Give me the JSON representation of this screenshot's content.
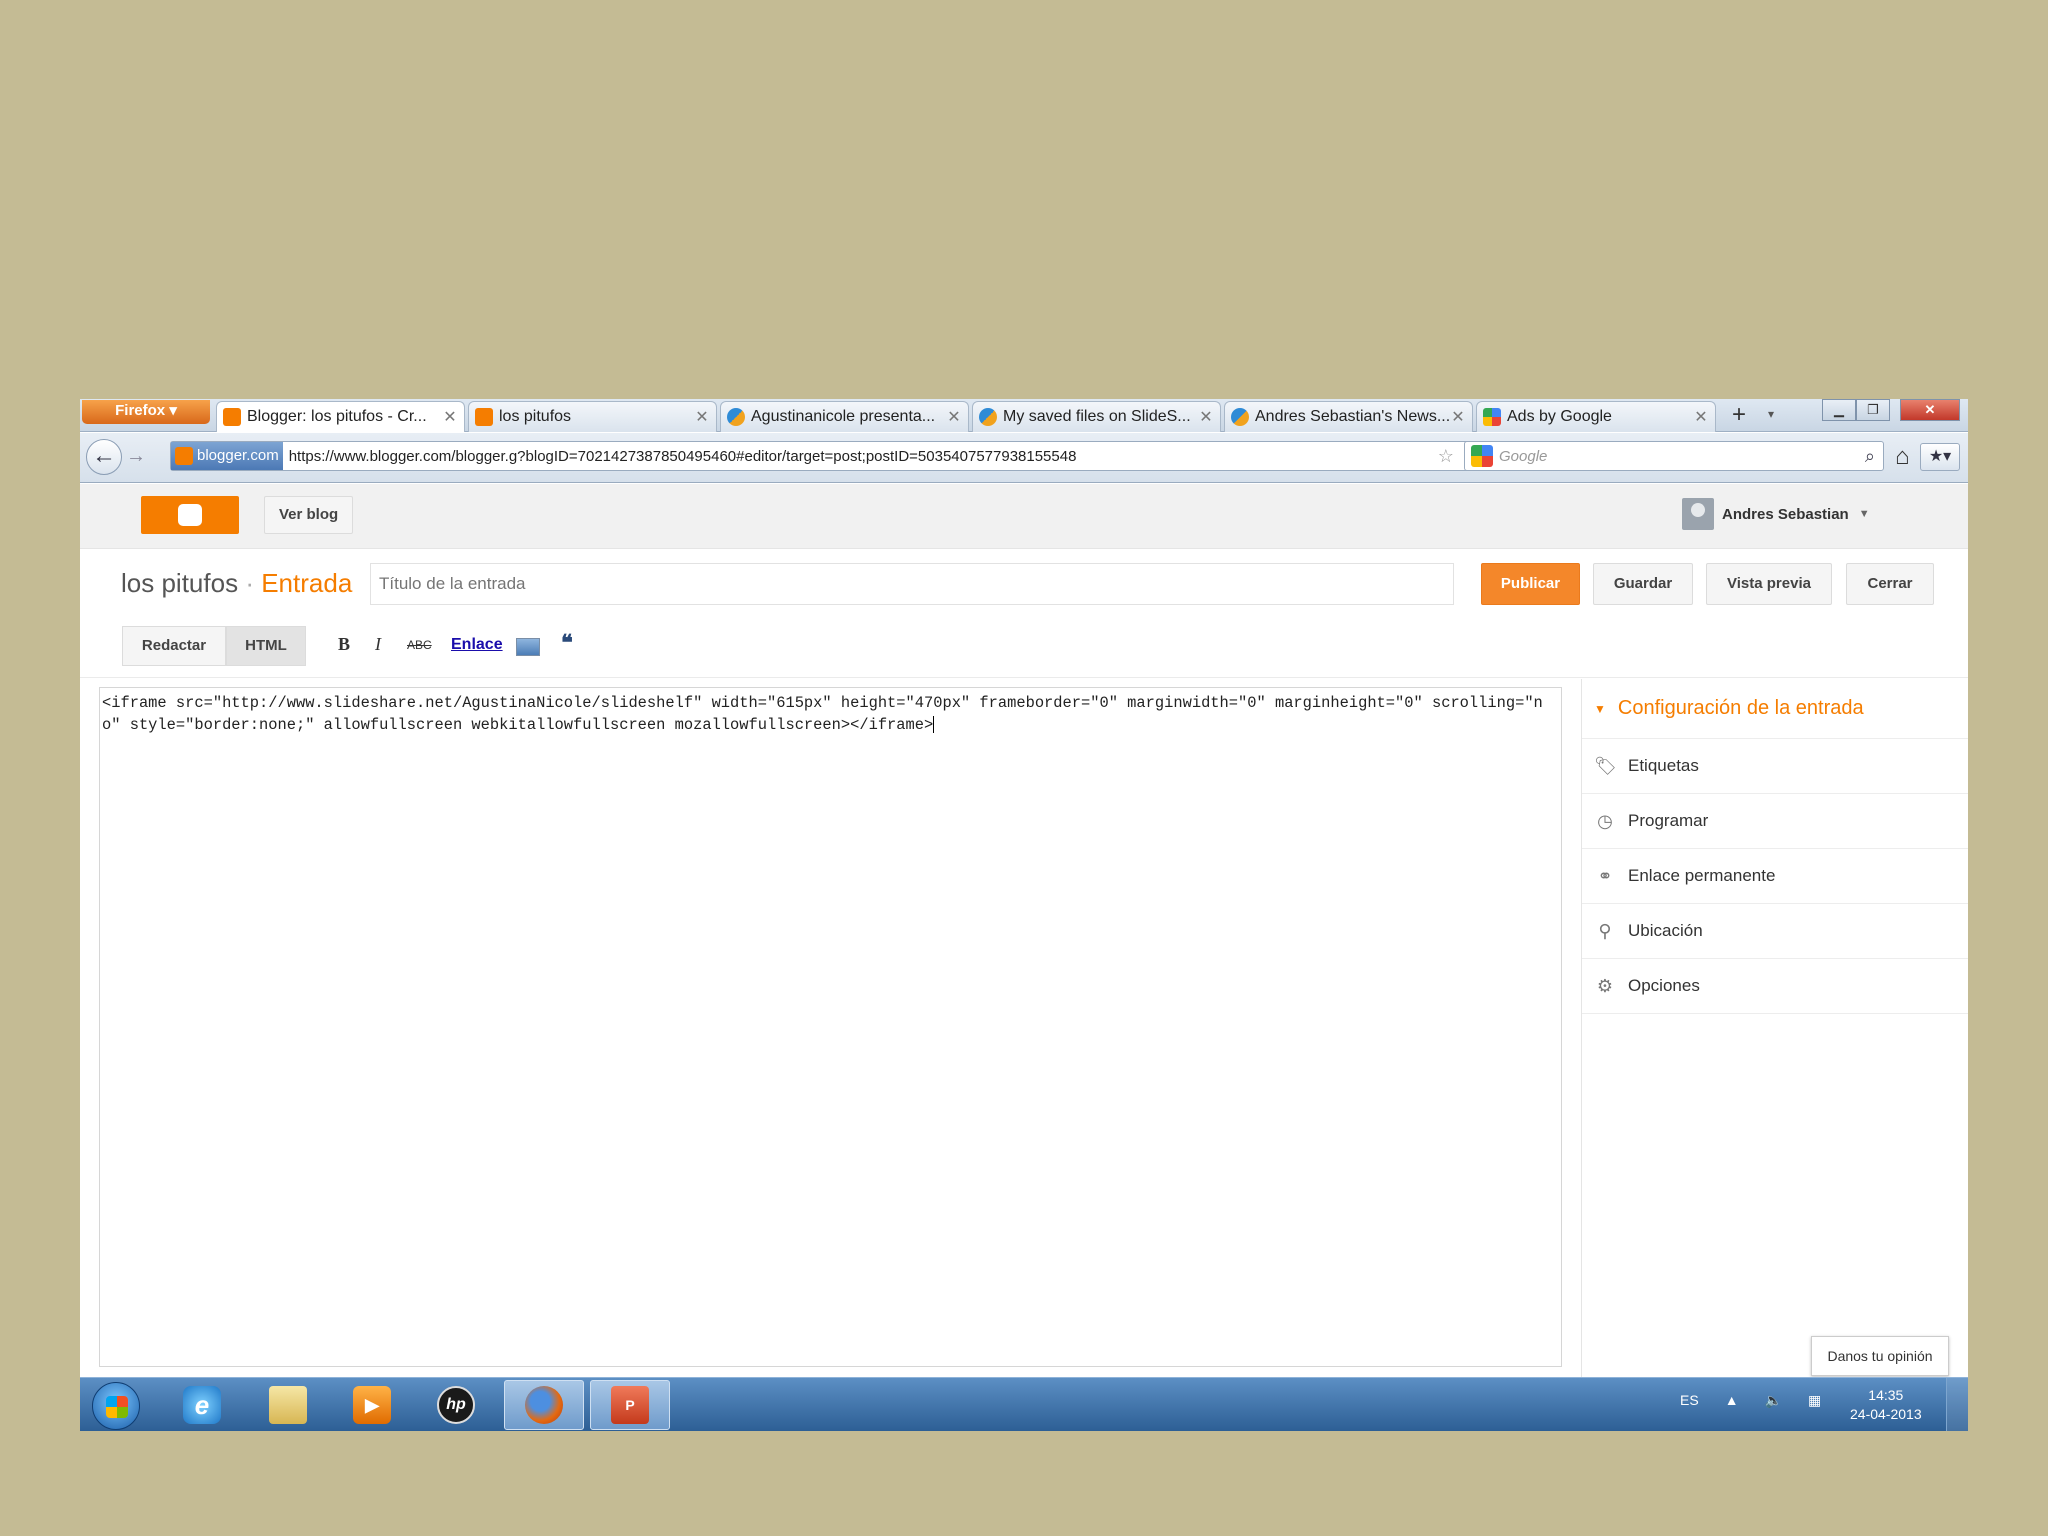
{
  "browser": {
    "menu_button": "Firefox",
    "tabs": [
      {
        "title": "Blogger: los pitufos - Cr...",
        "favicon": "blogger-icon",
        "active": true
      },
      {
        "title": "los pitufos",
        "favicon": "blogger-icon",
        "active": false
      },
      {
        "title": "Agustinanicole presenta...",
        "favicon": "slideshare-icon",
        "active": false
      },
      {
        "title": "My saved files on SlideS...",
        "favicon": "slideshare-icon",
        "active": false
      },
      {
        "title": "Andres Sebastian's News...",
        "favicon": "slideshare-icon",
        "active": false
      },
      {
        "title": "Ads by Google",
        "favicon": "google-icon",
        "active": false
      }
    ],
    "new_tab": "+",
    "identity": "blogger.com",
    "url": "https://www.blogger.com/blogger.g?blogID=7021427387850495460#editor/target=post;postID=5035407577938155548",
    "search_placeholder": "Google"
  },
  "blogger": {
    "ver_blog": "Ver blog",
    "user_name": "Andres Sebastian",
    "blog_name": "los pitufos",
    "separator": "·",
    "section": "Entrada",
    "title_placeholder": "Título de la entrada",
    "buttons": {
      "publish": "Publicar",
      "save": "Guardar",
      "preview": "Vista previa",
      "close": "Cerrar"
    },
    "modes": {
      "compose": "Redactar",
      "html": "HTML"
    },
    "toolbar": {
      "bold": "B",
      "italic": "I",
      "strike": "ABC",
      "link": "Enlace",
      "quote": "❝"
    },
    "editor_content": "<iframe src=\"http://www.slideshare.net/AgustinaNicole/slideshelf\" width=\"615px\" height=\"470px\" frameborder=\"0\" marginwidth=\"0\" marginheight=\"0\" scrolling=\"no\" style=\"border:none;\" allowfullscreen webkitallowfullscreen mozallowfullscreen></iframe>",
    "settings": {
      "title": "Configuración de la entrada",
      "items": [
        {
          "label": "Etiquetas",
          "icon": "tag-icon"
        },
        {
          "label": "Programar",
          "icon": "clock-icon"
        },
        {
          "label": "Enlace permanente",
          "icon": "link-icon"
        },
        {
          "label": "Ubicación",
          "icon": "pin-icon"
        },
        {
          "label": "Opciones",
          "icon": "gear-icon"
        }
      ]
    },
    "feedback": "Danos tu opinión"
  },
  "taskbar": {
    "language": "ES",
    "time": "14:35",
    "date": "24-04-2013"
  },
  "colors": {
    "background": "#c4bb94",
    "blogger_orange": "#f57d00",
    "publish": "#f4872a"
  }
}
